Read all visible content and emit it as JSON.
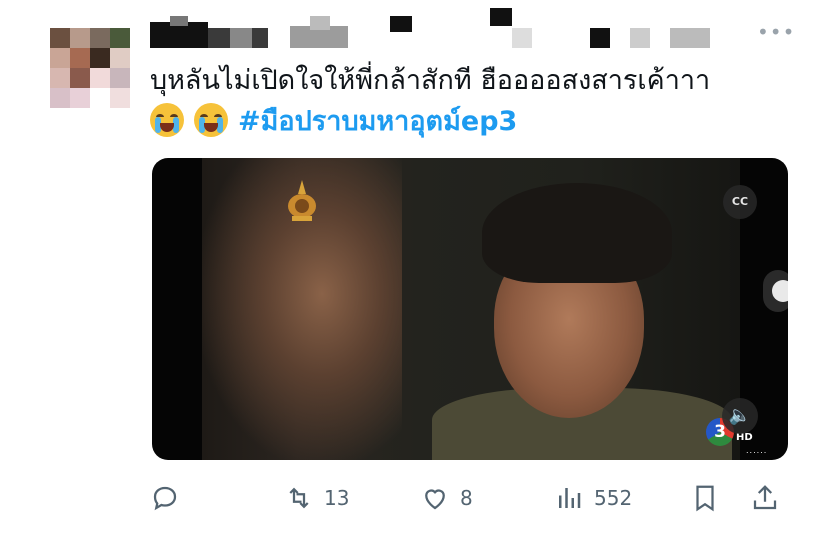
{
  "tweet": {
    "author": {
      "avatar_colors": [
        "#6b5040",
        "#b79a8b",
        "#7a6a5e",
        "#4a5a3a",
        "#c9a596",
        "#a66a52",
        "#3a2a20",
        "#e0ccc4",
        "#d7b7b0",
        "#8a5a4c",
        "#f1dada",
        "#c8b6bb",
        "#d8c0c8",
        "#e8d0d8",
        "#ffffff",
        "#f0dede"
      ]
    },
    "more_label": "•••",
    "text_line1": "บุหลันไม่เปิดใจให้พี่กล้าสักที ฮืออออสงสารเค้าาา",
    "emoji_name": "loudly-crying-face",
    "hashtag": "#มือปราบมหาอุตม์ep3",
    "media": {
      "cc_label": "CC",
      "channel_number": "3",
      "channel_hd": "HD",
      "channel_dots": "......",
      "volume_icon": "speaker-icon"
    },
    "actions": {
      "reply_icon": "reply-icon",
      "retweets": "13",
      "likes": "8",
      "views": "552",
      "bookmark_icon": "bookmark-icon",
      "share_icon": "share-icon"
    },
    "colors": {
      "accent": "#1d9bf0",
      "muted": "#536471"
    }
  }
}
